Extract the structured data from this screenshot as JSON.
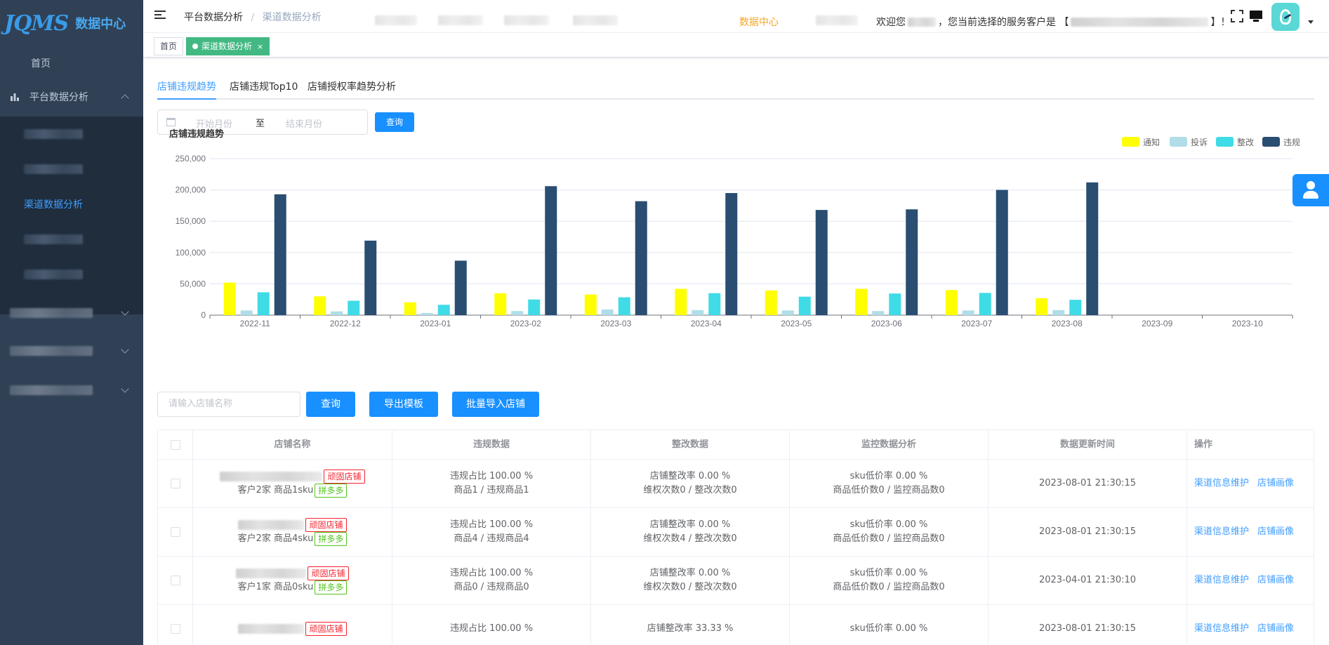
{
  "sidebar": {
    "logo_mark": "JQMS",
    "logo_name": "数据中心",
    "home_label": "首页",
    "group_label": "平台数据分析",
    "active_sub_label": "渠道数据分析"
  },
  "navbar": {
    "breadcrumb": [
      "平台数据分析",
      "渠道数据分析"
    ],
    "center_link": "数据中心",
    "welcome_prefix": "欢迎您",
    "welcome_middle": "，您当前选择的服务客户是 【",
    "welcome_suffix": "】！"
  },
  "tags_view": {
    "home": "首页",
    "active": "渠道数据分析",
    "close": "×"
  },
  "tabs": [
    "店铺违规趋势",
    "店铺违规Top10",
    "店铺授权率趋势分析"
  ],
  "filter": {
    "start_placeholder": "开始月份",
    "separator": "至",
    "end_placeholder": "结束月份",
    "query_label": "查询"
  },
  "chart_data": {
    "type": "bar",
    "title": "店铺违规趋势",
    "categories": [
      "2022-11",
      "2022-12",
      "2023-01",
      "2023-02",
      "2023-03",
      "2023-04",
      "2023-05",
      "2023-06",
      "2023-07",
      "2023-08",
      "2023-09",
      "2023-10"
    ],
    "series": [
      {
        "name": "通知",
        "color": "#ffff00",
        "values": [
          52000,
          30000,
          20500,
          35000,
          33000,
          42000,
          39500,
          42000,
          40000,
          27000,
          0,
          0
        ]
      },
      {
        "name": "投诉",
        "color": "#b0dde8",
        "values": [
          7500,
          6000,
          3500,
          6500,
          9000,
          8000,
          7500,
          6500,
          7500,
          8000,
          0,
          0
        ]
      },
      {
        "name": "整改",
        "color": "#3fdbe6",
        "values": [
          36500,
          23000,
          16500,
          25000,
          28500,
          35000,
          29500,
          34500,
          35500,
          24500,
          0,
          0
        ]
      },
      {
        "name": "违规",
        "color": "#2a4d72",
        "values": [
          193000,
          119000,
          87000,
          206000,
          182000,
          195000,
          168000,
          169000,
          200000,
          212000,
          0,
          0
        ]
      }
    ],
    "yticks": [
      "0",
      "50,000",
      "100,000",
      "150,000",
      "200,000",
      "250,000"
    ],
    "ylim": [
      0,
      250000
    ],
    "legend_position": "top-right",
    "grid": true
  },
  "actions": {
    "store_placeholder": "请输入店铺名称",
    "search_label": "查询",
    "export_label": "导出模板",
    "import_label": "批量导入店铺"
  },
  "table": {
    "headers": [
      "店铺名称",
      "违规数据",
      "整改数据",
      "监控数据分析",
      "数据更新时间",
      "操作"
    ],
    "rows": [
      {
        "store_badge": "顽固店铺",
        "store_sub": "客户2家 商品1sku",
        "platform_badge": "拼多多",
        "violation_ratio": "违规占比 100.00 %",
        "violation_detail": "商品1 / 违规商品1",
        "rectify_rate": "店铺整改率 0.00 %",
        "rectify_detail": "维权次数0 / 整改次数0",
        "monitor_rate": "sku低价率 0.00 %",
        "monitor_detail": "商品低价数0 / 监控商品数0",
        "updated": "2023-08-01 21:30:15",
        "op1": "渠道信息维护",
        "op2": "店铺画像"
      },
      {
        "store_badge": "顽固店铺",
        "store_sub": "客户2家 商品4sku",
        "platform_badge": "拼多多",
        "violation_ratio": "违规占比 100.00 %",
        "violation_detail": "商品4 / 违规商品4",
        "rectify_rate": "店铺整改率 0.00 %",
        "rectify_detail": "维权次数4 / 整改次数0",
        "monitor_rate": "sku低价率 0.00 %",
        "monitor_detail": "商品低价数0 / 监控商品数0",
        "updated": "2023-08-01 21:30:15",
        "op1": "渠道信息维护",
        "op2": "店铺画像"
      },
      {
        "store_badge": "顽固店铺",
        "store_sub": "客户1家 商品0sku",
        "platform_badge": "拼多多",
        "violation_ratio": "违规占比 100.00 %",
        "violation_detail": "商品0 / 违规商品0",
        "rectify_rate": "店铺整改率 0.00 %",
        "rectify_detail": "维权次数0 / 整改次数0",
        "monitor_rate": "sku低价率 0.00 %",
        "monitor_detail": "商品低价数0 / 监控商品数0",
        "updated": "2023-04-01 21:30:10",
        "op1": "渠道信息维护",
        "op2": "店铺画像"
      },
      {
        "store_badge": "顽固店铺",
        "store_sub": "",
        "platform_badge": "",
        "violation_ratio": "违规占比 100.00 %",
        "violation_detail": "",
        "rectify_rate": "店铺整改率 33.33 %",
        "rectify_detail": "",
        "monitor_rate": "sku低价率 0.00 %",
        "monitor_detail": "",
        "updated": "2023-08-01 21:30:15",
        "op1": "渠道信息维护",
        "op2": "店铺画像"
      }
    ]
  }
}
